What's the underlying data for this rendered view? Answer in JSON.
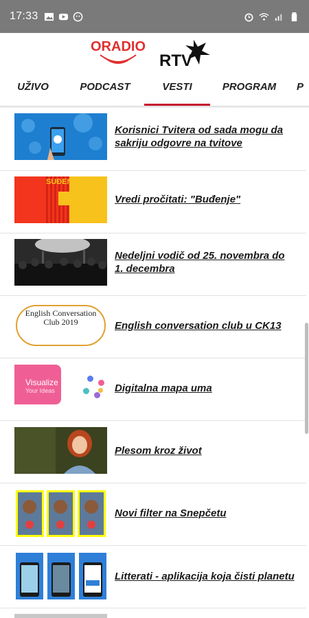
{
  "status_bar": {
    "time": "17:33",
    "left_icons": [
      "image-icon",
      "youtube-icon",
      "face-icon"
    ],
    "right_icons": [
      "alarm-icon",
      "wifi-icon",
      "signal-icon",
      "battery-icon"
    ]
  },
  "header": {
    "logo_left_text": "ORADIO",
    "logo_right_text": "RTV"
  },
  "tabs": [
    {
      "label": "UŽIVO",
      "active": false
    },
    {
      "label": "PODCAST",
      "active": false
    },
    {
      "label": "VESTI",
      "active": true
    },
    {
      "label": "PROGRAM",
      "active": false
    },
    {
      "label": "P",
      "active": false
    }
  ],
  "accent_color": "#c8102e",
  "news": [
    {
      "title": "Korisnici Tvitera od sada mogu da sakriju odgovre na tvitove",
      "thumb": "twitter-world-map"
    },
    {
      "title": "Vredi pročitati: \"Buđenje\"",
      "thumb": "book-cover-budjenje",
      "thumb_text": "SUĐENJE"
    },
    {
      "title": "Nedeljni vodič od 25. novembra do 1. decembra",
      "thumb": "concert-crowd"
    },
    {
      "title": "English conversation club u CK13",
      "thumb": "english-club-doodle",
      "thumb_text": "English Conversation Club 2019"
    },
    {
      "title": "Digitalna mapa uma",
      "thumb": "visualize-ideas",
      "thumb_text": "Visualize",
      "thumb_subtext": "Your Ideas"
    },
    {
      "title": "Plesom kroz život",
      "thumb": "woman-portrait"
    },
    {
      "title": "Novi filter na Snepčetu",
      "thumb": "snapchat-filter"
    },
    {
      "title": "Litterati - aplikacija koja čisti planetu",
      "thumb": "litterati-screens"
    }
  ]
}
